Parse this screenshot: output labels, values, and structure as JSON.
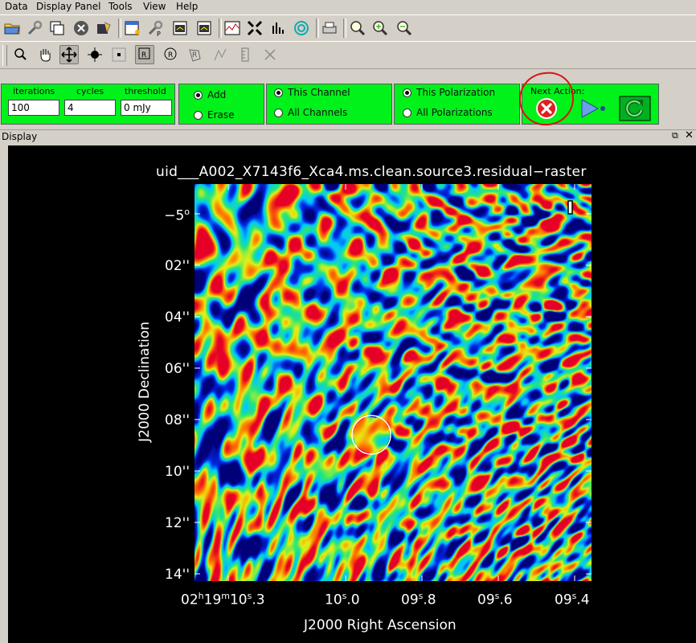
{
  "menu": [
    "Data",
    "Display Panel",
    "Tools",
    "View",
    "Help"
  ],
  "clean": {
    "iterations_label": "iterations",
    "iterations_value": "100",
    "cycles_label": "cycles",
    "cycles_value": "4",
    "threshold_label": "threshold",
    "threshold_value": "0 mJy",
    "add_label": "Add",
    "erase_label": "Erase",
    "this_channel_label": "This Channel",
    "all_channels_label": "All Channels",
    "this_pol_label": "This Polarization",
    "all_pol_label": "All Polarizations",
    "next_action_label": "Next Action:"
  },
  "panel": {
    "title": "Display"
  },
  "plot": {
    "title": "uid___A002_X7143f6_Xca4.ms.clean.source3.residual−raster",
    "dec_ticks": [
      "−5°",
      "02''",
      "04''",
      "06''",
      "08''",
      "10''",
      "12''",
      "14''"
    ],
    "ra_ticks": [
      "02h19m10s.3",
      "10s.0",
      "09s.8",
      "09s.6",
      "09s.4"
    ],
    "ra_axis_title": "J2000 Right Ascension",
    "dec_axis_title": "J2000 Declination"
  },
  "colors": {
    "clean_panel": "#00f21a",
    "display_bg": "#000000",
    "highlight": "#e01010"
  }
}
